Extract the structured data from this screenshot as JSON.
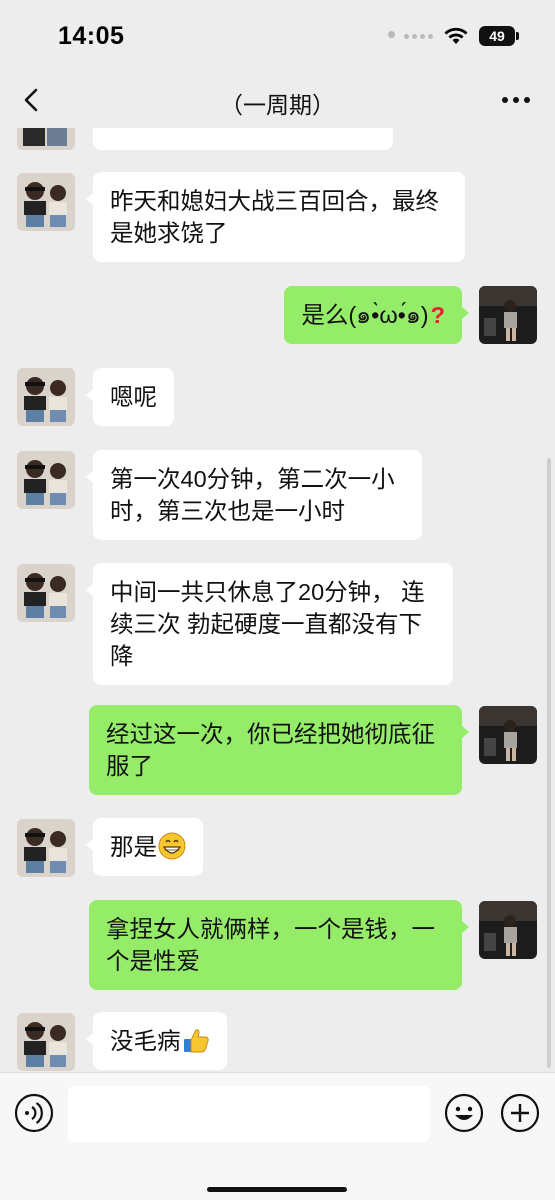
{
  "status_bar": {
    "time": "14:05",
    "battery": "49"
  },
  "header": {
    "title": "（一周期）"
  },
  "messages": [
    {
      "side": "in",
      "text": "昨天和媳妇大战三百回合，最终是她求饶了"
    },
    {
      "side": "out",
      "text": "是么(๑•̀ω•́๑)"
    },
    {
      "side": "in",
      "text": "嗯呢"
    },
    {
      "side": "in",
      "text": "第一次40分钟，第二次一小时，第三次也是一小时"
    },
    {
      "side": "in",
      "text": "中间一共只休息了20分钟， 连续三次 勃起硬度一直都没有下降"
    },
    {
      "side": "out",
      "text": "经过这一次，你已经把她彻底征服了"
    },
    {
      "side": "in",
      "text": "那是"
    },
    {
      "side": "out",
      "text": "拿捏女人就俩样，一个是钱，一个是性爱"
    },
    {
      "side": "in",
      "text": "没毛病"
    }
  ],
  "input": {
    "placeholder": ""
  },
  "icons": {
    "back": "chevron-left-icon",
    "more": "more-dots-icon",
    "voice": "voice-icon",
    "emoji": "emoji-icon",
    "plus": "plus-icon",
    "question": "red-question-mark-icon",
    "grin": "grinning-emoji-icon",
    "thumbs_up": "thumbs-up-emoji-icon"
  },
  "colors": {
    "outgoing_bubble": "#95ec69",
    "incoming_bubble": "#ffffff",
    "background": "#ededed"
  }
}
